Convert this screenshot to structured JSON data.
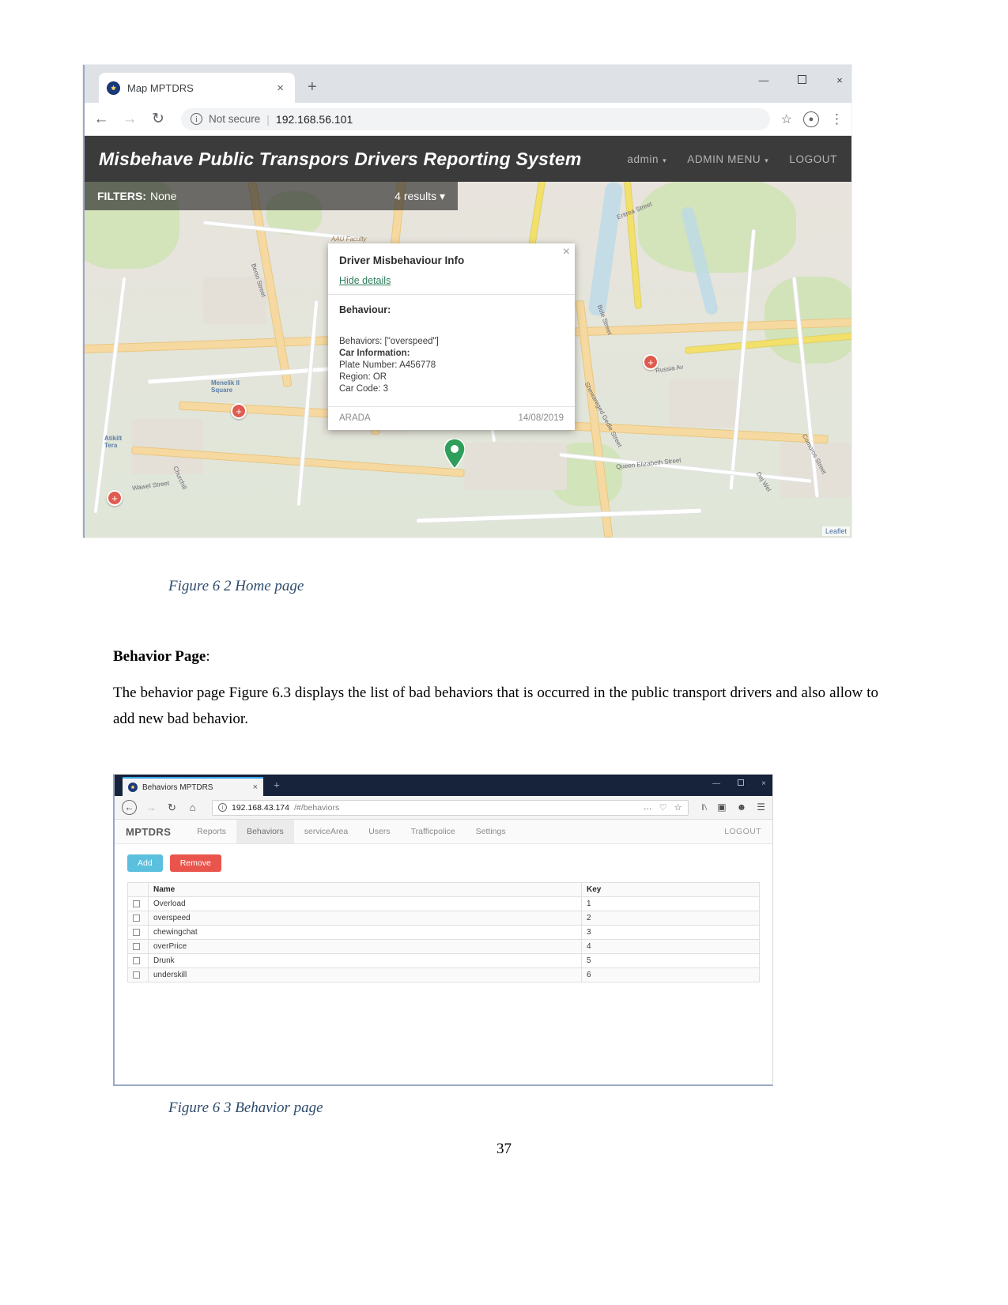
{
  "figure1": {
    "browser": {
      "tab_title": "Map MPTDRS",
      "close_glyph": "×",
      "newtab_glyph": "+",
      "back_glyph": "←",
      "forward_glyph": "→",
      "reload_glyph": "↻",
      "security_label": "Not secure",
      "separator": "|",
      "url": "192.168.56.101",
      "star_glyph": "☆",
      "profile_glyph": "●",
      "kebab_glyph": "⋮",
      "minimize_glyph": "—",
      "close_win_glyph": "×"
    },
    "app": {
      "title": "Misbehave Public Transpors Drivers Reporting System",
      "nav": [
        {
          "label": "admin",
          "caret": "▾"
        },
        {
          "label": "ADMIN MENU",
          "caret": "▾"
        },
        {
          "label": "LOGOUT",
          "caret": ""
        }
      ]
    },
    "filters": {
      "label": "FILTERS:",
      "value": "None",
      "results": "4 results",
      "caret": "▾"
    },
    "popup": {
      "title": "Driver Misbehaviour Info",
      "hide_details": "Hide details",
      "behaviour_label": "Behaviour:",
      "behaviors_line": "Behaviors: [\"overspeed\"]",
      "car_info_label": "Car Information:",
      "plate_number": "Plate Number: A456778",
      "region": "Region: OR",
      "car_code": "Car Code: 3",
      "footer_left": "ARADA",
      "footer_right": "14/08/2019",
      "close_glyph": "×"
    },
    "map": {
      "attribution": "Leaflet",
      "labels": [
        "AAU Faculty",
        "Menelik II Square",
        "Eritrea Street",
        "Russia Av",
        "Queen Elizabeth Street",
        "Comoros Street",
        "Wawel Street",
        "Benin Street",
        "Atikilt Tera",
        "Churchill",
        "Shewareged Gedle Street",
        "Bole Street",
        "Dej Wel"
      ]
    },
    "caption": "Figure 6 2 Home page"
  },
  "text": {
    "heading_bold": "Behavior Page",
    "heading_colon": ":",
    "paragraph": "The behavior page Figure 6.3 displays the list of bad behaviors that is occurred in the public transport drivers and also allow to add new bad behavior."
  },
  "figure2": {
    "browser": {
      "tab_title": "Behaviors MPTDRS",
      "close_glyph": "×",
      "newtab_glyph": "+",
      "back_glyph": "←",
      "forward_glyph": "→",
      "reload_glyph": "↻",
      "home_glyph": "⌂",
      "url_host": "192.168.43.174",
      "url_path": "/#/behaviors",
      "more_glyph": "…",
      "pocket_glyph": "♡",
      "star_glyph": "☆",
      "library_glyph": "‖\\",
      "sidebar_glyph": "▣",
      "account_glyph": "☻",
      "menu_glyph": "☰",
      "minimize_glyph": "—",
      "close_win_glyph": "×"
    },
    "app": {
      "brand": "MPTDRS",
      "nav": [
        "Reports",
        "Behaviors",
        "serviceArea",
        "Users",
        "Trafficpolice",
        "Settings"
      ],
      "active_nav": "Behaviors",
      "logout": "LOGOUT",
      "buttons": {
        "add": "Add",
        "remove": "Remove"
      },
      "table": {
        "columns": [
          "Name",
          "Key"
        ],
        "rows": [
          {
            "name": "Overload",
            "key": "1"
          },
          {
            "name": "overspeed",
            "key": "2"
          },
          {
            "name": "chewingchat",
            "key": "3"
          },
          {
            "name": "overPrice",
            "key": "4"
          },
          {
            "name": "Drunk",
            "key": "5"
          },
          {
            "name": "underskill",
            "key": "6"
          }
        ]
      }
    },
    "caption": "Figure 6 3 Behavior page"
  },
  "footer": {
    "page_number": "37"
  }
}
